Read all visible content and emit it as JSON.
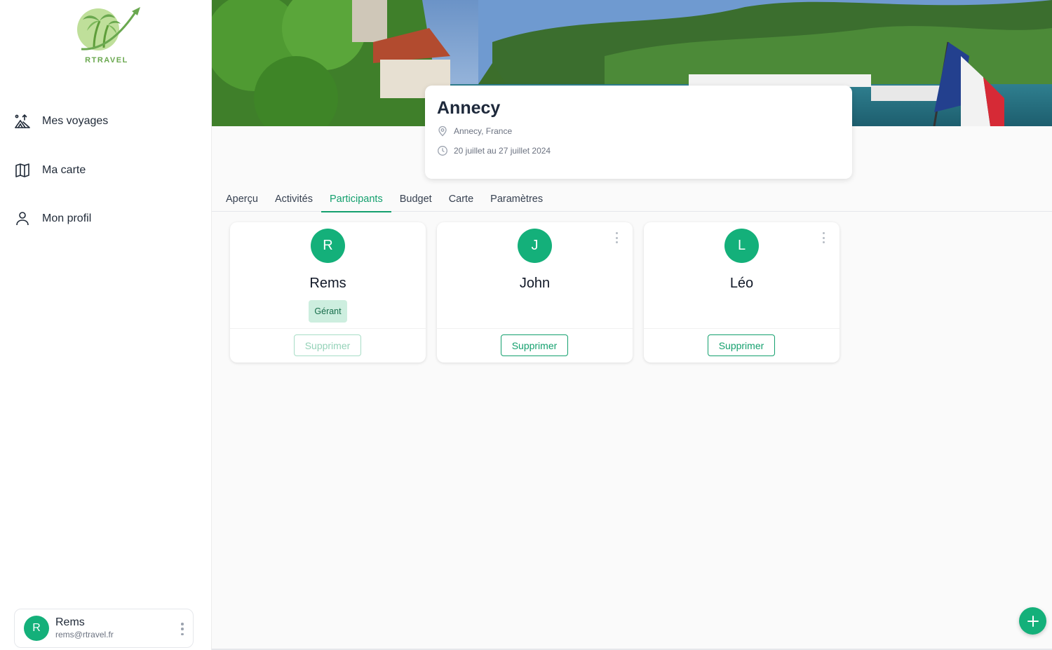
{
  "brand": {
    "name": "RTRAVEL"
  },
  "sidebar": {
    "items": [
      {
        "label": "Mes voyages",
        "icon": "travel-icon"
      },
      {
        "label": "Ma carte",
        "icon": "map-icon"
      },
      {
        "label": "Mon profil",
        "icon": "user-icon"
      }
    ]
  },
  "user": {
    "initial": "R",
    "name": "Rems",
    "email": "rems@rtravel.fr"
  },
  "trip": {
    "title": "Annecy",
    "location": "Annecy, France",
    "dates": "20 juillet au 27 juillet 2024"
  },
  "tabs": [
    {
      "label": "Aperçu"
    },
    {
      "label": "Activités"
    },
    {
      "label": "Participants"
    },
    {
      "label": "Budget"
    },
    {
      "label": "Carte"
    },
    {
      "label": "Paramètres"
    }
  ],
  "active_tab": "Participants",
  "participants": [
    {
      "initial": "R",
      "name": "Rems",
      "role": "Gérant",
      "delete_label": "Supprimer"
    },
    {
      "initial": "J",
      "name": "John",
      "delete_label": "Supprimer"
    },
    {
      "initial": "L",
      "name": "Léo",
      "delete_label": "Supprimer"
    }
  ],
  "colors": {
    "accent": "#14b07a",
    "accent_text": "#14a06e",
    "badge_bg": "#cdeedf"
  }
}
